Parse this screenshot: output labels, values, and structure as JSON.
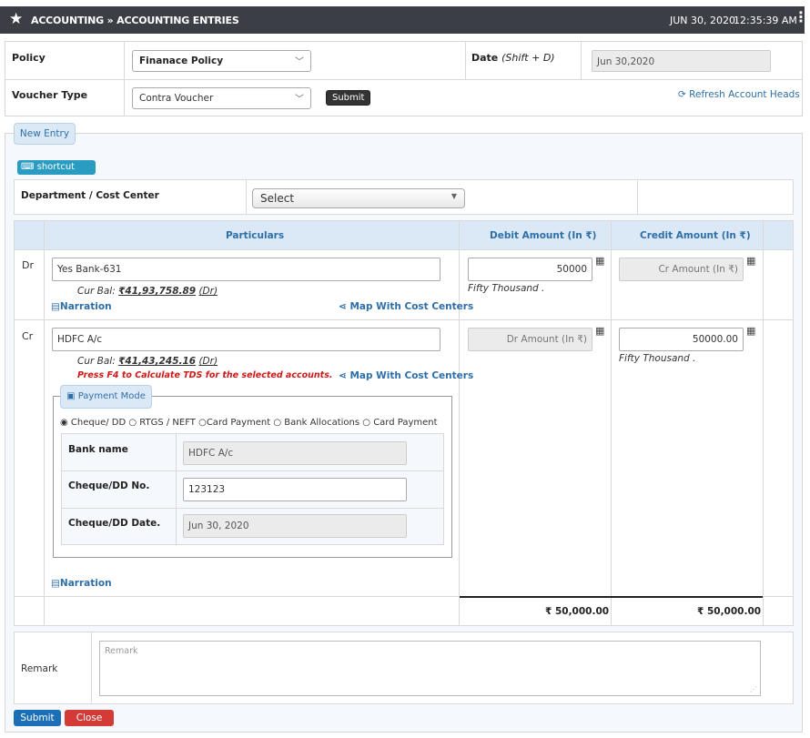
{
  "header": {
    "title": "ACCOUNTING » ACCOUNTING ENTRIES",
    "date": "JUN 30, 2020",
    "time": "12:35:39 AM"
  },
  "form": {
    "policy_label": "Policy",
    "policy_value": "Finanace Policy",
    "date_label": "Date",
    "date_hint": "(Shift + D)",
    "date_value": "Jun 30,2020",
    "voucher_type_label": "Voucher Type",
    "voucher_type_value": "Contra Voucher",
    "submit_label": "Submit",
    "refresh_label": "Refresh Account Heads"
  },
  "entry": {
    "legend": "New Entry",
    "shortcut_label": "shortcut keys",
    "dept_label": "Department / Cost Center",
    "dept_value": "Select",
    "columns": {
      "particulars": "Particulars",
      "debit": "Debit Amount (In ₹)",
      "credit": "Credit Amount (In ₹)"
    },
    "dr": {
      "type": "Dr",
      "account": "Yes Bank-631",
      "bal_label": "Cur Bal:",
      "bal_value": "₹41,93,758.89",
      "bal_suffix": "(Dr)",
      "narration": "Narration",
      "map": "Map With Cost Centers",
      "debit_value": "50000",
      "debit_words": "Fifty Thousand .",
      "credit_placeholder": "Cr Amount (In ₹)"
    },
    "cr": {
      "type": "Cr",
      "account": "HDFC A/c",
      "bal_label": "Cur Bal:",
      "bal_value": "₹41,43,245.16",
      "bal_suffix": "(Dr)",
      "tds_note": "Press F4 to Calculate TDS for the selected accounts.",
      "map": "Map With Cost Centers",
      "narration": "Narration",
      "debit_placeholder": "Dr Amount (In ₹)",
      "credit_value": "50000.00",
      "credit_words": "Fifty Thousand ."
    },
    "payment": {
      "legend": "Payment Mode",
      "options": [
        "Cheque/ DD",
        "RTGS / NEFT",
        "Card Payment",
        "Bank Allocations",
        "Card Payment"
      ],
      "selected": "Cheque/ DD",
      "bank_name_label": "Bank name",
      "bank_name_value": "HDFC A/c",
      "cheque_no_label": "Cheque/DD No.",
      "cheque_no_value": "123123",
      "cheque_date_label": "Cheque/DD Date.",
      "cheque_date_value": "Jun 30, 2020"
    },
    "totals": {
      "debit": "₹ 50,000.00",
      "credit": "₹ 50,000.00"
    },
    "remark_label": "Remark",
    "remark_placeholder": "Remark"
  },
  "actions": {
    "submit_label": "Submit",
    "close_label": "Close"
  }
}
